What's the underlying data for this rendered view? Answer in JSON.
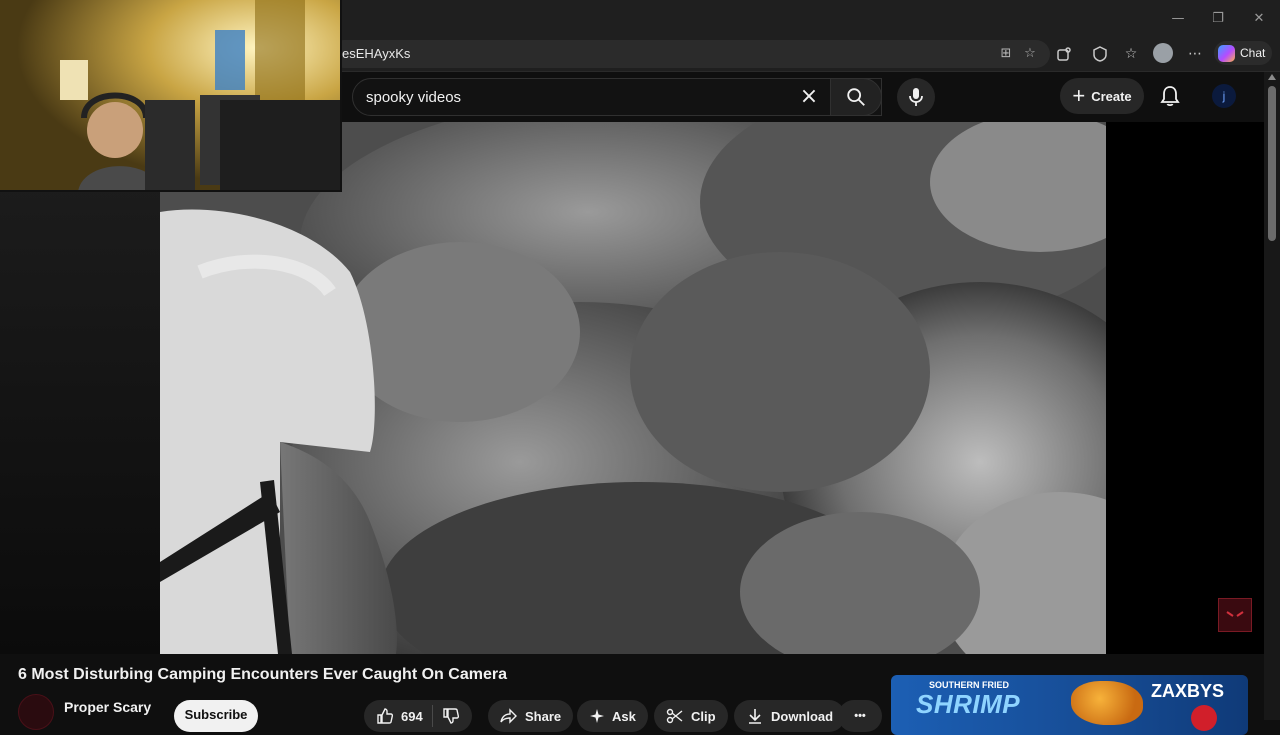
{
  "browser": {
    "url_visible": "esEHAyxKs",
    "copilot_label": "Chat",
    "icons": [
      "split-screen-icon",
      "favorite-star-icon",
      "extensions-icon",
      "browser-essentials-icon",
      "favorites-icon",
      "profile-icon",
      "more-icon",
      "copilot-icon"
    ],
    "window_controls": {
      "minimize": "—",
      "restore": "❐",
      "close": "✕"
    }
  },
  "masthead": {
    "search_query": "spooky videos",
    "create_label": "Create",
    "account_initial": "j"
  },
  "video": {
    "title": "6 Most Disturbing Camping Encounters Ever Caught On Camera",
    "channel_name": "Proper Scary",
    "subscribe_label": "Subscribe",
    "like_count": "694",
    "actions": {
      "share": "Share",
      "ask": "Ask",
      "clip": "Clip",
      "download": "Download",
      "more": "•••"
    }
  },
  "ad": {
    "kicker": "SOUTHERN FRIED",
    "headline": "SHRIMP",
    "brand": "ZAXBYS"
  },
  "colors": {
    "background": "#0f0f0f",
    "surface": "#272727",
    "text": "#f1f1f1",
    "accent_subscribe": "#f1f1f1",
    "ad_blue": "#1c5fb4"
  }
}
